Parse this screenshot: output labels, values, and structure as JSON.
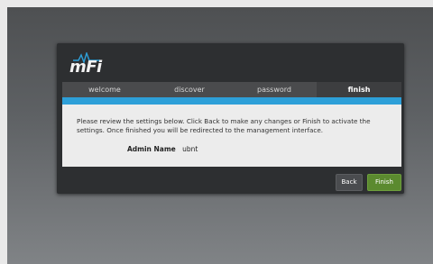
{
  "app": {
    "logo_text": "mFi"
  },
  "wizard": {
    "steps": [
      {
        "label": "welcome"
      },
      {
        "label": "discover"
      },
      {
        "label": "password"
      },
      {
        "label": "finish"
      }
    ],
    "active_step": "finish",
    "description": "Please review the settings below. Click Back to make any changes or Finish to activate the settings. Once finished you will be redirected to the management interface.",
    "fields": {
      "admin_name_label": "Admin Name",
      "admin_name_value": "ubnt"
    },
    "buttons": {
      "back_label": "Back",
      "finish_label": "Finish"
    }
  },
  "colors": {
    "accent": "#2d9fd8",
    "finish_button": "#5b8a2f",
    "panel": "#2d2f31"
  }
}
